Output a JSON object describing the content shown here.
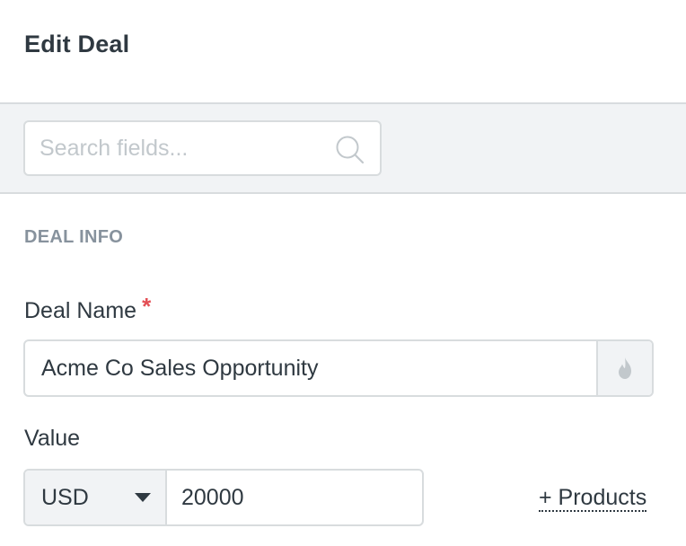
{
  "header": {
    "title": "Edit Deal"
  },
  "search": {
    "placeholder": "Search fields...",
    "value": "",
    "icon": "search-icon"
  },
  "section": {
    "label": "DEAL INFO"
  },
  "deal_name": {
    "label": "Deal Name",
    "required_mark": "*",
    "value": "Acme Co Sales Opportunity",
    "addon_icon": "flame-icon"
  },
  "value": {
    "label": "Value",
    "currency": "USD",
    "amount": "20000",
    "products_link": "+ Products"
  },
  "colors": {
    "required": "#e34f55",
    "border": "#d8dcde",
    "band_background": "#f1f3f5",
    "text": "#2f3941",
    "muted": "#87929d"
  }
}
